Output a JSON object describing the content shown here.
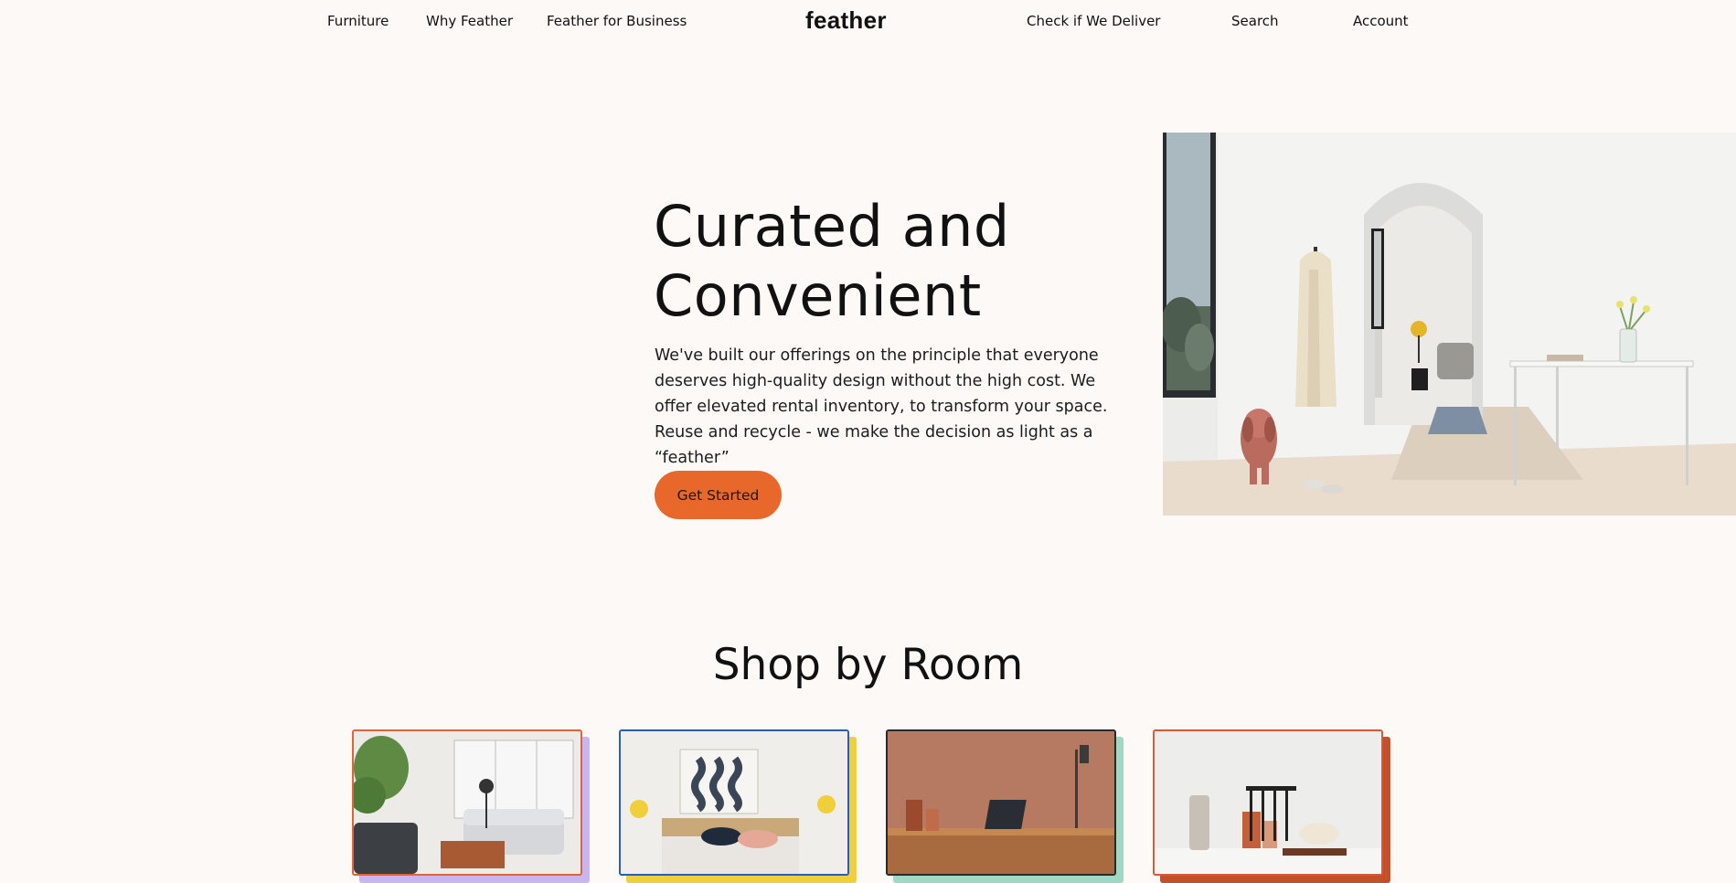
{
  "nav": {
    "furniture": "Furniture",
    "why_feather": "Why Feather",
    "business": "Feather for Business",
    "logo": "feather",
    "deliver": "Check if We Deliver",
    "search": "Search",
    "account": "Account"
  },
  "hero": {
    "title_line1": "Curated and",
    "title_line2": "Convenient",
    "body": "We've built our offerings on the principle that everyone deserves high-quality design without the high cost. We offer elevated rental inventory, to transform your space. Reuse and recycle - we make the decision as light as a “feather”",
    "cta": "Get Started"
  },
  "shop": {
    "title": "Shop by Room"
  },
  "colors": {
    "background": "#fcf9f7",
    "accent": "#e8682b",
    "card_borders": [
      "#e0643a",
      "#2c5cb8",
      "#2a2a2a",
      "#d8583a"
    ],
    "card_shadows": [
      "#c9b6f0",
      "#f0cf3a",
      "#9fd9c3",
      "#c4502a"
    ]
  },
  "room_cards": [
    {
      "room": "living-room",
      "icon": "living-room-photo"
    },
    {
      "room": "bedroom",
      "icon": "bedroom-photo"
    },
    {
      "room": "home-office",
      "icon": "home-office-photo"
    },
    {
      "room": "dining-room",
      "icon": "dining-room-photo"
    }
  ]
}
